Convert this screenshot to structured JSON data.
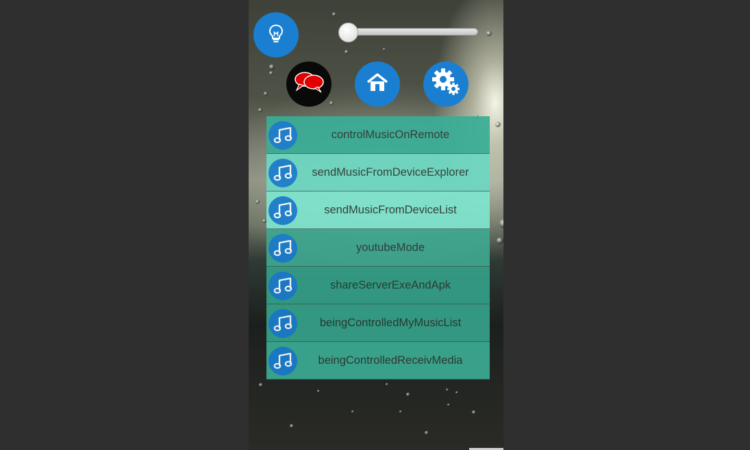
{
  "colors": {
    "accent": "#1a7fd0",
    "list_item_backgrounds": [
      "#3aae96",
      "#6dd8c2",
      "#7fe6cf",
      "#3fa890",
      "#34a088",
      "#35a28a",
      "#3cac93"
    ]
  },
  "top_bar": {
    "light_button_icon": "lightbulb-icon",
    "volume_slider": {
      "value_fraction": 0.0
    }
  },
  "nav": {
    "chat_icon": "chat-bubbles-icon",
    "home_icon": "home-icon",
    "settings_icon": "settings-gear-icon"
  },
  "menu": {
    "item_icon": "music-note-icon",
    "items": [
      {
        "label": "controlMusicOnRemote"
      },
      {
        "label": "sendMusicFromDeviceExplorer"
      },
      {
        "label": "sendMusicFromDeviceList"
      },
      {
        "label": "youtubeMode"
      },
      {
        "label": "shareServerExeAndApk"
      },
      {
        "label": "beingControlledMyMusicList"
      },
      {
        "label": "beingControlledReceivMedia"
      }
    ]
  }
}
